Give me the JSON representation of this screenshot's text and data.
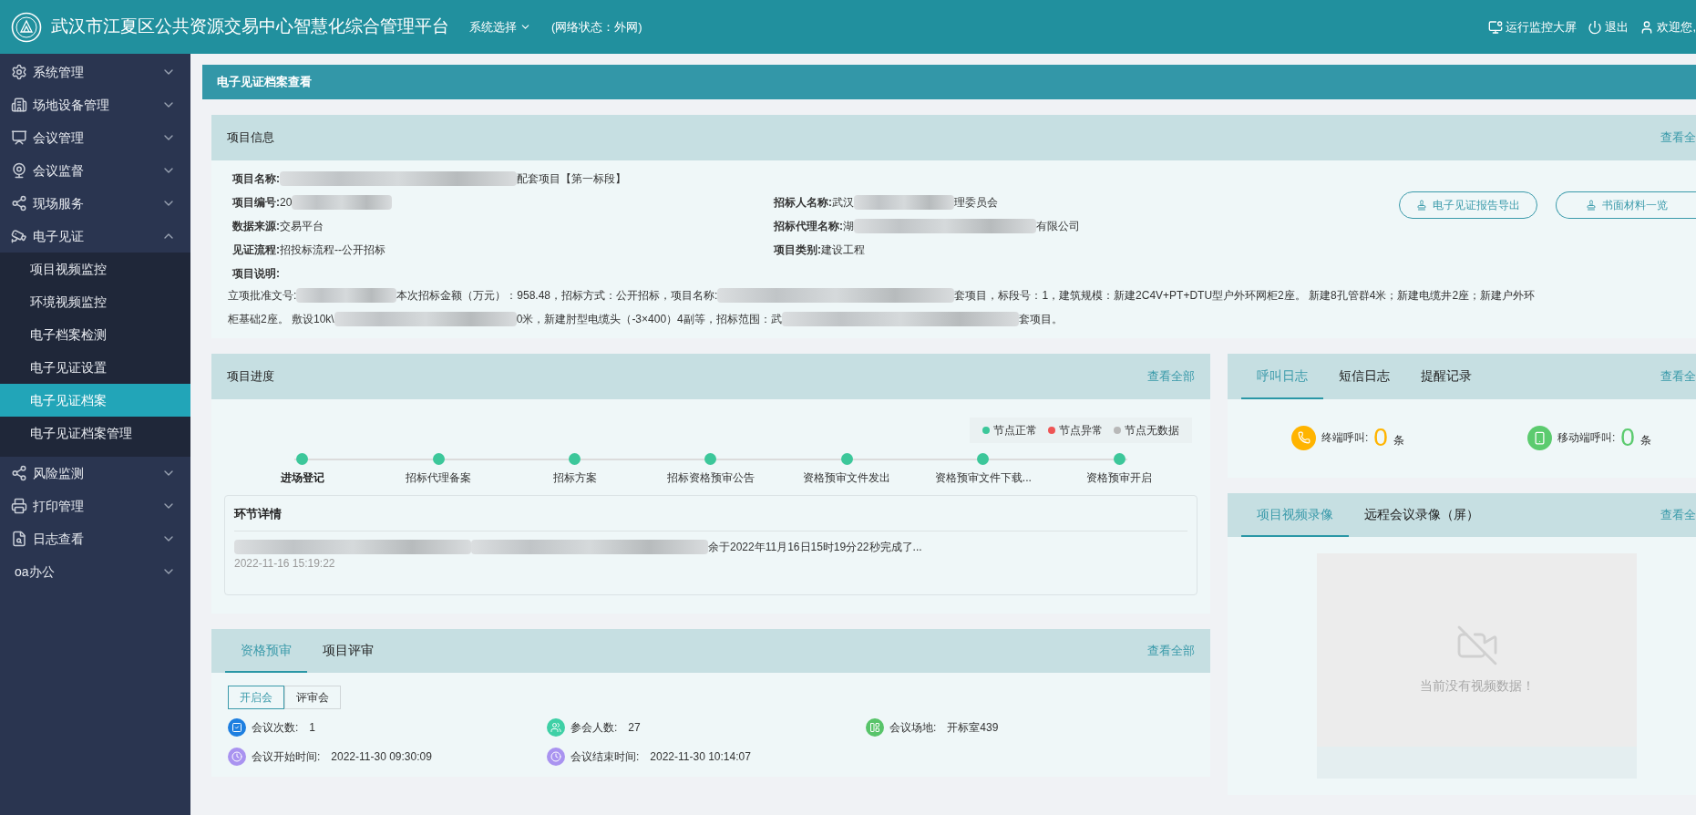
{
  "header": {
    "title": "武汉市江夏区公共资源交易中心智慧化综合管理平台",
    "system_select": "系统选择",
    "network": "(网络状态：外网)",
    "actions": [
      {
        "kind": "monitor",
        "label": "运行监控大屏"
      },
      {
        "kind": "power",
        "label": "退出"
      },
      {
        "kind": "user",
        "label": "欢迎您,"
      }
    ]
  },
  "sidebar": {
    "items": [
      {
        "kind": "gear",
        "label": "系统管理",
        "expanded": false
      },
      {
        "kind": "building",
        "label": "场地设备管理",
        "expanded": false
      },
      {
        "kind": "meeting",
        "label": "会议管理",
        "expanded": false
      },
      {
        "kind": "webcam",
        "label": "会议监督",
        "expanded": false
      },
      {
        "kind": "nodes",
        "label": "现场服务",
        "expanded": false
      },
      {
        "kind": "cctv",
        "label": "电子见证",
        "expanded": true,
        "children": [
          {
            "label": "项目视频监控",
            "selected": false
          },
          {
            "label": "环境视频监控",
            "selected": false
          },
          {
            "label": "电子档案检测",
            "selected": false
          },
          {
            "label": "电子见证设置",
            "selected": false
          },
          {
            "label": "电子见证档案",
            "selected": true
          },
          {
            "label": "电子见证档案管理",
            "selected": false
          }
        ]
      },
      {
        "kind": "nodes",
        "label": "风险监测",
        "expanded": false
      },
      {
        "kind": "printer",
        "label": "打印管理",
        "expanded": false
      },
      {
        "kind": "log",
        "label": "日志查看",
        "expanded": false
      },
      {
        "kind": "none",
        "label": "oa办公",
        "expanded": false
      }
    ]
  },
  "page_title": "电子见证档案查看",
  "project_info": {
    "title": "项目信息",
    "view_all": "查看全",
    "fields": [
      {
        "label": "项目名称:",
        "parts": [
          {
            "kind": "redacted_long"
          },
          {
            "kind": "text",
            "text": "配套项目【第一标段】"
          }
        ]
      },
      {
        "label": "项目编号:",
        "parts": [
          {
            "kind": "text",
            "text": "20"
          },
          {
            "kind": "redacted_short"
          }
        ]
      },
      {
        "label": "招标人名称:",
        "parts": [
          {
            "kind": "text",
            "text": "武汉"
          },
          {
            "kind": "redacted_short"
          },
          {
            "kind": "text",
            "text": "理委员会"
          }
        ]
      },
      {
        "label": "数据来源:",
        "parts": [
          {
            "kind": "text",
            "text": "交易平台"
          }
        ]
      },
      {
        "label": "招标代理名称:",
        "parts": [
          {
            "kind": "text",
            "text": "湖"
          },
          {
            "kind": "redacted_medium"
          },
          {
            "kind": "text",
            "text": "有限公司"
          }
        ]
      },
      {
        "label": "见证流程:",
        "parts": [
          {
            "kind": "text",
            "text": "招投标流程--公开招标"
          }
        ]
      },
      {
        "label": "项目类别:",
        "parts": [
          {
            "kind": "text",
            "text": "建设工程"
          }
        ]
      }
    ],
    "buttons": [
      {
        "label": "电子见证报告导出"
      },
      {
        "label": "书面材料一览"
      }
    ],
    "description_label": "项目说明:",
    "description_lines": [
      [
        {
          "kind": "text",
          "text": "立项批准文号:"
        },
        {
          "kind": "redacted_short"
        },
        {
          "kind": "text",
          "text": "本次招标金额（万元）：958.48，招标方式：公开招标，项目名称:"
        },
        {
          "kind": "redacted_long"
        },
        {
          "kind": "text",
          "text": "套项目，标段号：1，建筑规模：新建2C4V+PT+DTU型户外环网柜2座。 新建8孔管群4米；新建电缆井2座；新建户外环"
        }
      ],
      [
        {
          "kind": "text",
          "text": "柜基础2座。 敷设10k\\"
        },
        {
          "kind": "redacted_medium"
        },
        {
          "kind": "text",
          "text": "0米，新建肘型电缆头（-3×400）4副等，招标范围：武"
        },
        {
          "kind": "redacted_long"
        },
        {
          "kind": "text",
          "text": "套项目。"
        }
      ]
    ]
  },
  "progress": {
    "title": "项目进度",
    "view_all": "查看全部",
    "legend": [
      {
        "label": "节点正常",
        "color": "#3cc79a"
      },
      {
        "label": "节点异常",
        "color": "#ee5555"
      },
      {
        "label": "节点无数据",
        "color": "#b8b8b8"
      }
    ],
    "steps": [
      {
        "label": "进场登记",
        "color": "#3cc79a",
        "selected": true
      },
      {
        "label": "招标代理备案",
        "color": "#3cc79a",
        "selected": false
      },
      {
        "label": "招标方案",
        "color": "#3cc79a",
        "selected": false
      },
      {
        "label": "招标资格预审公告",
        "color": "#3cc79a",
        "selected": false
      },
      {
        "label": "资格预审文件发出",
        "color": "#3cc79a",
        "selected": false
      },
      {
        "label": "资格预审文件下载...",
        "color": "#3cc79a",
        "selected": false
      },
      {
        "label": "资格预审开启",
        "color": "#3cc79a",
        "selected": false
      }
    ],
    "detail": {
      "title": "环节详情",
      "text": "余于2022年11月16日15时19分22秒完成了...",
      "time": "2022-11-16 15:19:22"
    }
  },
  "call_log": {
    "tabs": [
      {
        "label": "呼叫日志",
        "selected": true
      },
      {
        "label": "短信日志",
        "selected": false
      },
      {
        "label": "提醒记录",
        "selected": false
      }
    ],
    "view_all": "查看全",
    "stats": [
      {
        "kind": "terminal",
        "label": "终端呼叫:",
        "count": "0",
        "unit": "条",
        "color": "#ffb400"
      },
      {
        "kind": "mobile",
        "label": "移动端呼叫:",
        "count": "0",
        "unit": "条",
        "color": "#5ccb6f"
      }
    ]
  },
  "video": {
    "tabs": [
      {
        "label": "项目视频录像",
        "selected": true
      },
      {
        "label": "远程会议录像（屏）",
        "selected": false
      }
    ],
    "view_all": "查看全",
    "empty_text": "当前没有视频数据！"
  },
  "review": {
    "tabs": [
      {
        "label": "资格预审",
        "selected": true
      },
      {
        "label": "项目评审",
        "selected": false
      }
    ],
    "view_all": "查看全部",
    "toggles": [
      {
        "label": "开启会",
        "selected": true
      },
      {
        "label": "评审会",
        "selected": false
      }
    ],
    "stats": [
      {
        "kind": "count",
        "label": "会议次数:",
        "value": "1",
        "color": "#1e7fe0"
      },
      {
        "kind": "people",
        "label": "参会人数:",
        "value": "27",
        "color": "#3fd0a6"
      },
      {
        "kind": "venue",
        "label": "会议场地:",
        "value": "开标室439",
        "color": "#58c46a"
      },
      {
        "kind": "clock",
        "label": "会议开始时间:",
        "value": "2022-11-30 09:30:09",
        "color": "#a993f0"
      },
      {
        "kind": "clock",
        "label": "会议结束时间:",
        "value": "2022-11-30 10:14:07",
        "color": "#a993f0"
      }
    ]
  }
}
